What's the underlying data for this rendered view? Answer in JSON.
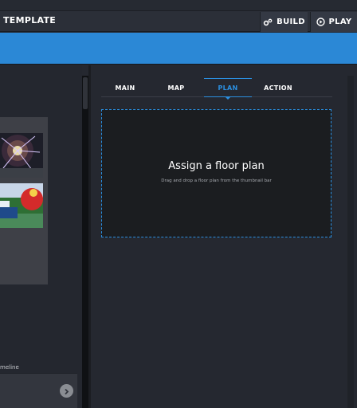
{
  "header": {
    "app_title": "TEMPLATE",
    "build_label": "BUILD",
    "play_label": "PLAY"
  },
  "left_panel": {
    "timeline_label": "meline"
  },
  "tabs": [
    {
      "label": "MAIN",
      "active": false
    },
    {
      "label": "MAP",
      "active": false
    },
    {
      "label": "PLAN",
      "active": true
    },
    {
      "label": "ACTION",
      "active": false
    }
  ],
  "dropzone": {
    "title": "Assign a floor plan",
    "subtitle": "Drag and drop a floor plan from the thumbnail bar"
  },
  "colors": {
    "accent": "#2b88d6",
    "tab_active": "#2b8fe0",
    "background": "#252830"
  },
  "icons": {
    "build": "gears-icon",
    "play": "play-circle-icon",
    "next": "chevron-right-icon"
  }
}
